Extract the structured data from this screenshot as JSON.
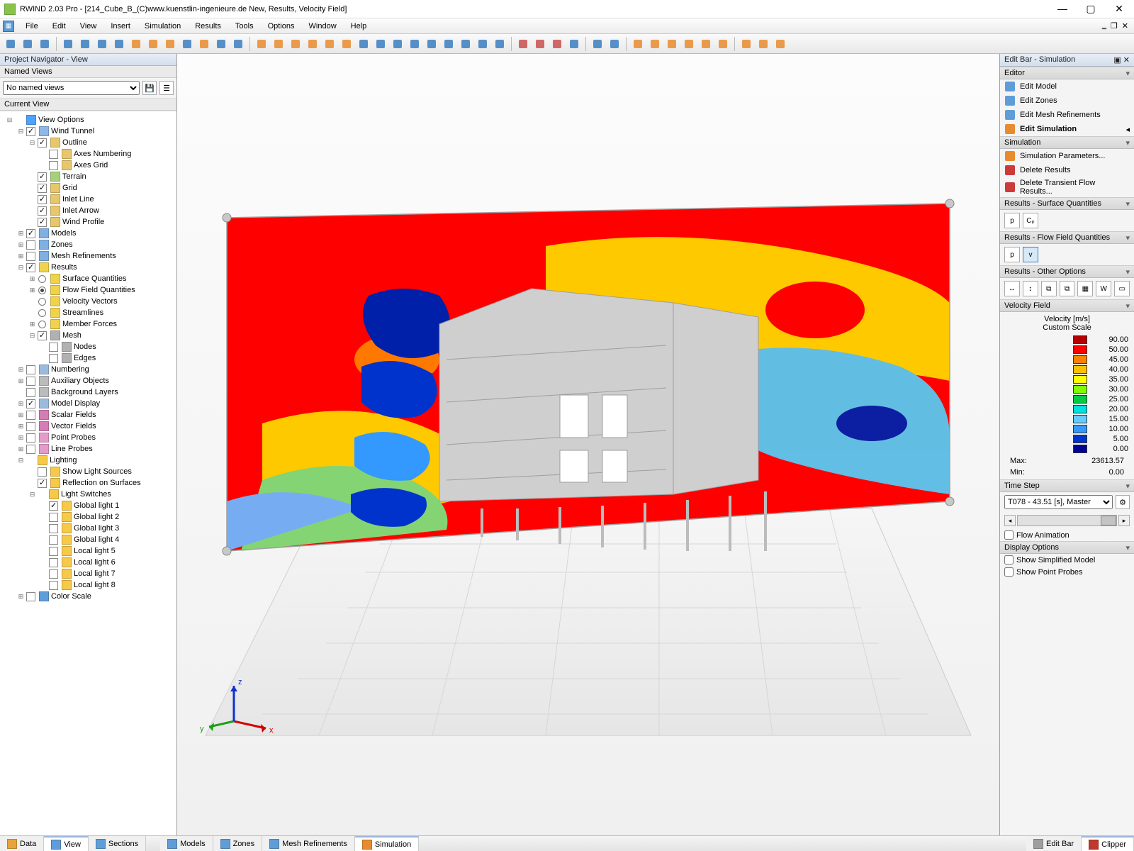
{
  "window": {
    "title": "RWIND 2.03 Pro - [214_Cube_B_(C)www.kuenstlin-ingenieure.de New, Results, Velocity Field]"
  },
  "menu": [
    "File",
    "Edit",
    "View",
    "Insert",
    "Simulation",
    "Results",
    "Tools",
    "Options",
    "Window",
    "Help"
  ],
  "left": {
    "navigator_title": "Project Navigator - View",
    "named_views": "Named Views",
    "named_views_combo": "No named views",
    "current_view": "Current View",
    "tree": [
      {
        "ind": 0,
        "exp": "-",
        "chk": null,
        "ic": "#4da3ff",
        "label": "View Options"
      },
      {
        "ind": 1,
        "exp": "-",
        "chk": true,
        "ic": "#8fb8e8",
        "label": "Wind Tunnel"
      },
      {
        "ind": 2,
        "exp": "-",
        "chk": true,
        "ic": "#e8c66c",
        "label": "Outline"
      },
      {
        "ind": 3,
        "exp": "",
        "chk": false,
        "ic": "#e8c66c",
        "label": "Axes Numbering"
      },
      {
        "ind": 3,
        "exp": "",
        "chk": false,
        "ic": "#e8c66c",
        "label": "Axes Grid"
      },
      {
        "ind": 2,
        "exp": "",
        "chk": true,
        "ic": "#a6d17c",
        "label": "Terrain"
      },
      {
        "ind": 2,
        "exp": "",
        "chk": true,
        "ic": "#e8c66c",
        "label": "Grid"
      },
      {
        "ind": 2,
        "exp": "",
        "chk": true,
        "ic": "#e8c66c",
        "label": "Inlet Line"
      },
      {
        "ind": 2,
        "exp": "",
        "chk": true,
        "ic": "#e8c66c",
        "label": "Inlet Arrow"
      },
      {
        "ind": 2,
        "exp": "",
        "chk": true,
        "ic": "#e8c66c",
        "label": "Wind Profile"
      },
      {
        "ind": 1,
        "exp": "+",
        "chk": true,
        "ic": "#7fb0e2",
        "label": "Models"
      },
      {
        "ind": 1,
        "exp": "+",
        "chk": false,
        "ic": "#7fb0e2",
        "label": "Zones"
      },
      {
        "ind": 1,
        "exp": "+",
        "chk": false,
        "ic": "#7fb0e2",
        "label": "Mesh Refinements"
      },
      {
        "ind": 1,
        "exp": "-",
        "chk": true,
        "ic": "#f1d24b",
        "label": "Results"
      },
      {
        "ind": 2,
        "exp": "+",
        "rad": false,
        "ic": "#f1d24b",
        "label": "Surface Quantities"
      },
      {
        "ind": 2,
        "exp": "+",
        "rad": true,
        "ic": "#f1d24b",
        "label": "Flow Field Quantities"
      },
      {
        "ind": 2,
        "exp": "",
        "rad": false,
        "ic": "#f1d24b",
        "label": "Velocity Vectors"
      },
      {
        "ind": 2,
        "exp": "",
        "rad": false,
        "ic": "#f1d24b",
        "label": "Streamlines"
      },
      {
        "ind": 2,
        "exp": "+",
        "rad": false,
        "ic": "#f1d24b",
        "label": "Member Forces"
      },
      {
        "ind": 2,
        "exp": "-",
        "chk": true,
        "ic": "#b1b1b1",
        "label": "Mesh"
      },
      {
        "ind": 3,
        "exp": "",
        "chk": false,
        "ic": "#b1b1b1",
        "label": "Nodes"
      },
      {
        "ind": 3,
        "exp": "",
        "chk": false,
        "ic": "#b1b1b1",
        "label": "Edges"
      },
      {
        "ind": 1,
        "exp": "+",
        "chk": false,
        "ic": "#9bbbde",
        "label": "Numbering"
      },
      {
        "ind": 1,
        "exp": "+",
        "chk": false,
        "ic": "#bbbbbb",
        "label": "Auxiliary Objects"
      },
      {
        "ind": 1,
        "exp": "",
        "chk": false,
        "ic": "#bbbbbb",
        "label": "Background Layers"
      },
      {
        "ind": 1,
        "exp": "+",
        "chk": true,
        "ic": "#9bbbde",
        "label": "Model Display"
      },
      {
        "ind": 1,
        "exp": "+",
        "chk": false,
        "ic": "#d47db5",
        "label": "Scalar Fields"
      },
      {
        "ind": 1,
        "exp": "+",
        "chk": false,
        "ic": "#d47db5",
        "label": "Vector Fields"
      },
      {
        "ind": 1,
        "exp": "+",
        "chk": false,
        "ic": "#e49bc8",
        "label": "Point Probes"
      },
      {
        "ind": 1,
        "exp": "+",
        "chk": false,
        "ic": "#e49bc8",
        "label": "Line Probes"
      },
      {
        "ind": 1,
        "exp": "-",
        "chk": null,
        "ic": "#f7c948",
        "label": "Lighting"
      },
      {
        "ind": 2,
        "exp": "",
        "chk": false,
        "ic": "#f7c948",
        "label": "Show Light Sources"
      },
      {
        "ind": 2,
        "exp": "",
        "chk": true,
        "ic": "#f7c948",
        "label": "Reflection on Surfaces"
      },
      {
        "ind": 2,
        "exp": "-",
        "chk": null,
        "ic": "#f7c948",
        "label": "Light Switches"
      },
      {
        "ind": 3,
        "exp": "",
        "chk": true,
        "ic": "#f7c948",
        "label": "Global light 1"
      },
      {
        "ind": 3,
        "exp": "",
        "chk": false,
        "ic": "#f7c948",
        "label": "Global light 2"
      },
      {
        "ind": 3,
        "exp": "",
        "chk": false,
        "ic": "#f7c948",
        "label": "Global light 3"
      },
      {
        "ind": 3,
        "exp": "",
        "chk": false,
        "ic": "#f7c948",
        "label": "Global light 4"
      },
      {
        "ind": 3,
        "exp": "",
        "chk": false,
        "ic": "#f7c948",
        "label": "Local light 5"
      },
      {
        "ind": 3,
        "exp": "",
        "chk": false,
        "ic": "#f7c948",
        "label": "Local light 6"
      },
      {
        "ind": 3,
        "exp": "",
        "chk": false,
        "ic": "#f7c948",
        "label": "Local light 7"
      },
      {
        "ind": 3,
        "exp": "",
        "chk": false,
        "ic": "#f7c948",
        "label": "Local light 8"
      },
      {
        "ind": 1,
        "exp": "+",
        "chk": false,
        "ic": "#5e9dd8",
        "label": "Color Scale"
      }
    ]
  },
  "right": {
    "title": "Edit Bar - Simulation",
    "editor_header": "Editor",
    "editor_items": [
      {
        "icon": "#5e9dd8",
        "label": "Edit Model"
      },
      {
        "icon": "#5e9dd8",
        "label": "Edit Zones"
      },
      {
        "icon": "#5e9dd8",
        "label": "Edit Mesh Refinements"
      },
      {
        "icon": "#e88b2e",
        "label": "Edit Simulation",
        "bold": true,
        "arrow": true
      }
    ],
    "simulation_header": "Simulation",
    "simulation_items": [
      {
        "icon": "#e88b2e",
        "label": "Simulation Parameters..."
      },
      {
        "icon": "#cc3a3a",
        "label": "Delete Results"
      },
      {
        "icon": "#cc3a3a",
        "label": "Delete Transient Flow Results..."
      }
    ],
    "surf_header": "Results - Surface Quantities",
    "surf_btns": [
      "p",
      "Cₚ"
    ],
    "flow_header": "Results - Flow Field Quantities",
    "flow_btns": [
      "p",
      "v"
    ],
    "flow_active_idx": 1,
    "other_header": "Results - Other Options",
    "vel_header": "Velocity Field",
    "legend": {
      "title": "Velocity [m/s]",
      "subtitle": "Custom Scale",
      "rows": [
        {
          "c": "#b30000",
          "v": "90.00"
        },
        {
          "c": "#ff0000",
          "v": "50.00"
        },
        {
          "c": "#ff8000",
          "v": "45.00"
        },
        {
          "c": "#ffbf00",
          "v": "40.00"
        },
        {
          "c": "#ffff00",
          "v": "35.00"
        },
        {
          "c": "#80ff00",
          "v": "30.00"
        },
        {
          "c": "#00cc44",
          "v": "25.00"
        },
        {
          "c": "#00e0e0",
          "v": "20.00"
        },
        {
          "c": "#66ccff",
          "v": "15.00"
        },
        {
          "c": "#3399ff",
          "v": "10.00"
        },
        {
          "c": "#0033cc",
          "v": "5.00"
        },
        {
          "c": "#000099",
          "v": "0.00"
        }
      ],
      "max_label": "Max:",
      "max": "23613.57",
      "min_label": "Min:",
      "min": "0.00"
    },
    "timestep_header": "Time Step",
    "timestep_value": "T078 - 43.51 [s], Master",
    "flow_anim": "Flow Animation",
    "display_header": "Display Options",
    "show_simplified": "Show Simplified Model",
    "show_probes": "Show Point Probes"
  },
  "bottom": {
    "left": [
      {
        "label": "Data",
        "icon": "#e8a33a"
      },
      {
        "label": "View",
        "icon": "#5e9dd8",
        "active": true
      },
      {
        "label": "Sections",
        "icon": "#5e9dd8"
      }
    ],
    "mid": [
      {
        "label": "Models",
        "icon": "#5e9dd8"
      },
      {
        "label": "Zones",
        "icon": "#5e9dd8"
      },
      {
        "label": "Mesh Refinements",
        "icon": "#5e9dd8"
      },
      {
        "label": "Simulation",
        "icon": "#e88b2e",
        "active": true
      }
    ],
    "right": [
      {
        "label": "Edit Bar",
        "icon": "#9e9e9e"
      },
      {
        "label": "Clipper",
        "icon": "#c0392b",
        "active": true
      }
    ]
  },
  "chart_data": {
    "type": "table",
    "title": "Velocity [m/s] Custom Scale",
    "categories": [
      "90.00",
      "50.00",
      "45.00",
      "40.00",
      "35.00",
      "30.00",
      "25.00",
      "20.00",
      "15.00",
      "10.00",
      "5.00",
      "0.00"
    ],
    "colors": [
      "#b30000",
      "#ff0000",
      "#ff8000",
      "#ffbf00",
      "#ffff00",
      "#80ff00",
      "#00cc44",
      "#00e0e0",
      "#66ccff",
      "#3399ff",
      "#0033cc",
      "#000099"
    ],
    "stats": {
      "max": 23613.57,
      "min": 0.0
    }
  }
}
